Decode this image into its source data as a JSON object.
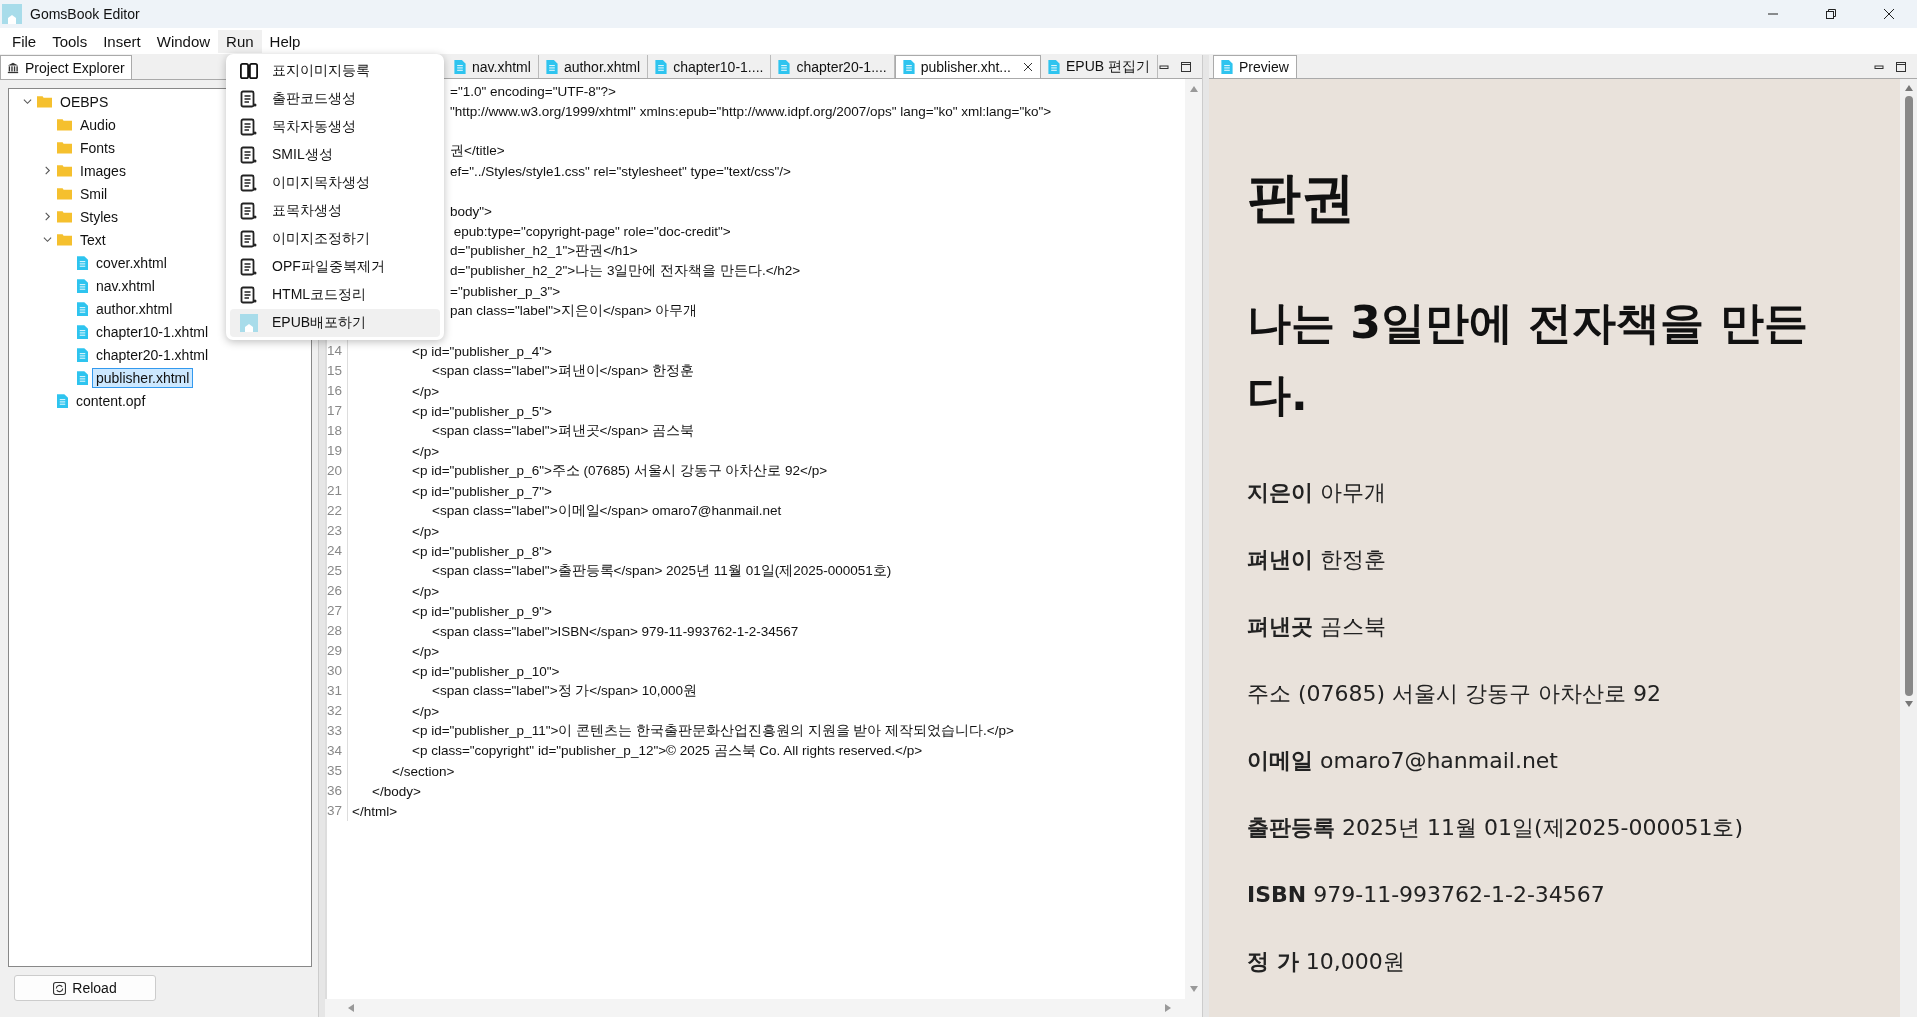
{
  "window": {
    "title": "GomsBook Editor"
  },
  "menu_bar": [
    {
      "label": "File",
      "selected": false
    },
    {
      "label": "Tools",
      "selected": false
    },
    {
      "label": "Insert",
      "selected": false
    },
    {
      "label": "Window",
      "selected": false
    },
    {
      "label": "Run",
      "selected": true
    },
    {
      "label": "Help",
      "selected": false
    }
  ],
  "run_menu": [
    {
      "label": "표지이미지등록",
      "kind": "book",
      "selected": false
    },
    {
      "label": "출판코드생성",
      "kind": "doc",
      "selected": false
    },
    {
      "label": "목차자동생성",
      "kind": "doc",
      "selected": false
    },
    {
      "label": "SMIL생성",
      "kind": "doc",
      "selected": false
    },
    {
      "label": "이미지목차생성",
      "kind": "doc",
      "selected": false
    },
    {
      "label": "표목차생성",
      "kind": "doc",
      "selected": false
    },
    {
      "label": "이미지조정하기",
      "kind": "doc",
      "selected": false
    },
    {
      "label": "OPF파일중복제거",
      "kind": "doc",
      "selected": false
    },
    {
      "label": "HTML코드정리",
      "kind": "doc",
      "selected": false
    },
    {
      "label": "EPUB배포하기",
      "kind": "app",
      "selected": true
    }
  ],
  "project_explorer": {
    "title": "Project Explorer",
    "reload_button": "Reload",
    "tree": [
      {
        "label": "OEBPS",
        "kind": "folder",
        "expanded": true,
        "children": [
          {
            "label": "Audio",
            "kind": "folder"
          },
          {
            "label": "Fonts",
            "kind": "folder"
          },
          {
            "label": "Images",
            "kind": "folder",
            "expanded": false
          },
          {
            "label": "Smil",
            "kind": "folder"
          },
          {
            "label": "Styles",
            "kind": "folder",
            "expanded": false
          },
          {
            "label": "Text",
            "kind": "folder",
            "expanded": true,
            "children": [
              {
                "label": "cover.xhtml",
                "kind": "file",
                "selected": false
              },
              {
                "label": "nav.xhtml",
                "kind": "file",
                "selected": false
              },
              {
                "label": "author.xhtml",
                "kind": "file",
                "selected": false
              },
              {
                "label": "chapter10-1.xhtml",
                "kind": "file",
                "selected": false
              },
              {
                "label": "chapter20-1.xhtml",
                "kind": "file",
                "selected": false
              },
              {
                "label": "publisher.xhtml",
                "kind": "file",
                "selected": true
              }
            ]
          },
          {
            "label": "content.opf",
            "kind": "file",
            "selected": false
          }
        ]
      }
    ]
  },
  "editor": {
    "tabs": [
      {
        "label": "nav.xhtml",
        "selected": false,
        "closable": false
      },
      {
        "label": "author.xhtml",
        "selected": false,
        "closable": false
      },
      {
        "label": "chapter10-1....",
        "selected": false,
        "closable": false
      },
      {
        "label": "chapter20-1....",
        "selected": false,
        "closable": false
      },
      {
        "label": "publisher.xht...",
        "selected": true,
        "closable": true
      },
      {
        "label": "EPUB 편집기",
        "selected": false,
        "closable": false
      }
    ],
    "lines": [
      {
        "kind": "partial",
        "text": "=\"1.0\" encoding=\"UTF-8\"?>"
      },
      {
        "kind": "partial",
        "text": "\"http://www.w3.org/1999/xhtml\" xmlns:epub=\"http://www.idpf.org/2007/ops\" lang=\"ko\" xml:lang=\"ko\">"
      },
      {
        "kind": "hidden"
      },
      {
        "kind": "partial",
        "text": "권</title>"
      },
      {
        "kind": "partial",
        "text": "ef=\"../Styles/style1.css\" rel=\"stylesheet\" type=\"text/css\"/>"
      },
      {
        "kind": "hidden"
      },
      {
        "kind": "partial",
        "text": "body\">"
      },
      {
        "kind": "partial",
        "text": " epub:type=\"copyright-page\" role=\"doc-credit\">"
      },
      {
        "kind": "partial",
        "text": "d=\"publisher_h2_1\">판권</h1>"
      },
      {
        "kind": "partial",
        "text": "d=\"publisher_h2_2\">나는 3일만에 전자책을 만든다.</h2>"
      },
      {
        "kind": "partial",
        "text": "=\"publisher_p_3\">"
      },
      {
        "kind": "partial",
        "text": "pan class=\"label\">지은이</span> 아무개"
      },
      {
        "kind": "hidden"
      },
      {
        "kind": "full",
        "number": "14",
        "text": "\t\t\t<p id=\"publisher_p_4\">"
      },
      {
        "kind": "full",
        "number": "15",
        "text": "\t\t\t\t<span class=\"label\">펴낸이</span> 한정훈"
      },
      {
        "kind": "full",
        "number": "16",
        "text": "\t\t\t</p>"
      },
      {
        "kind": "full",
        "number": "17",
        "text": "\t\t\t<p id=\"publisher_p_5\">"
      },
      {
        "kind": "full",
        "number": "18",
        "text": "\t\t\t\t<span class=\"label\">펴낸곳</span> 곰스북"
      },
      {
        "kind": "full",
        "number": "19",
        "text": "\t\t\t</p>"
      },
      {
        "kind": "full",
        "number": "20",
        "text": "\t\t\t<p id=\"publisher_p_6\">주소 (07685) 서울시 강동구 아차산로 92</p>"
      },
      {
        "kind": "full",
        "number": "21",
        "text": "\t\t\t<p id=\"publisher_p_7\">"
      },
      {
        "kind": "full",
        "number": "22",
        "text": "\t\t\t\t<span class=\"label\">이메일</span> omaro7@hanmail.net"
      },
      {
        "kind": "full",
        "number": "23",
        "text": "\t\t\t</p>"
      },
      {
        "kind": "full",
        "number": "24",
        "text": "\t\t\t<p id=\"publisher_p_8\">"
      },
      {
        "kind": "full",
        "number": "25",
        "text": "\t\t\t\t<span class=\"label\">출판등록</span> 2025년 11월 01일(제2025-000051호)"
      },
      {
        "kind": "full",
        "number": "26",
        "text": "\t\t\t</p>"
      },
      {
        "kind": "full",
        "number": "27",
        "text": "\t\t\t<p id=\"publisher_p_9\">"
      },
      {
        "kind": "full",
        "number": "28",
        "text": "\t\t\t\t<span class=\"label\">ISBN</span> 979-11-993762-1-2-34567"
      },
      {
        "kind": "full",
        "number": "29",
        "text": "\t\t\t</p>"
      },
      {
        "kind": "full",
        "number": "30",
        "text": "\t\t\t<p id=\"publisher_p_10\">"
      },
      {
        "kind": "full",
        "number": "31",
        "text": "\t\t\t\t<span class=\"label\">정 가</span> 10,000원"
      },
      {
        "kind": "full",
        "number": "32",
        "text": "\t\t\t</p>"
      },
      {
        "kind": "full",
        "number": "33",
        "text": "\t\t\t<p id=\"publisher_p_11\">이 콘텐츠는 한국출판문화산업진흥원의 지원을 받아 제작되었습니다.</p>"
      },
      {
        "kind": "full",
        "number": "34",
        "text": "\t\t\t<p class=\"copyright\" id=\"publisher_p_12\">© 2025 곰스북 Co. All rights reserved.</p>"
      },
      {
        "kind": "full",
        "number": "35",
        "text": "\t\t</section>"
      },
      {
        "kind": "full",
        "number": "36",
        "text": "\t</body>"
      },
      {
        "kind": "full",
        "number": "37",
        "text": "</html>"
      }
    ]
  },
  "preview": {
    "title": "Preview",
    "heading": "판권",
    "subheading": "나는 3일만에 전자책을 만든다.",
    "paragraphs": [
      "**지은이** 아무개",
      "**펴낸이** 한정훈",
      "**펴낸곳** 곰스북",
      "주소 (07685) 서울시 강동구 아차산로 92",
      "**이메일** omaro7@hanmail.net",
      "**출판등록** 2025년 11월 01일(제2025-000051호)",
      "**ISBN** 979-11-993762-1-2-34567",
      "**정 가** 10,000원"
    ]
  }
}
